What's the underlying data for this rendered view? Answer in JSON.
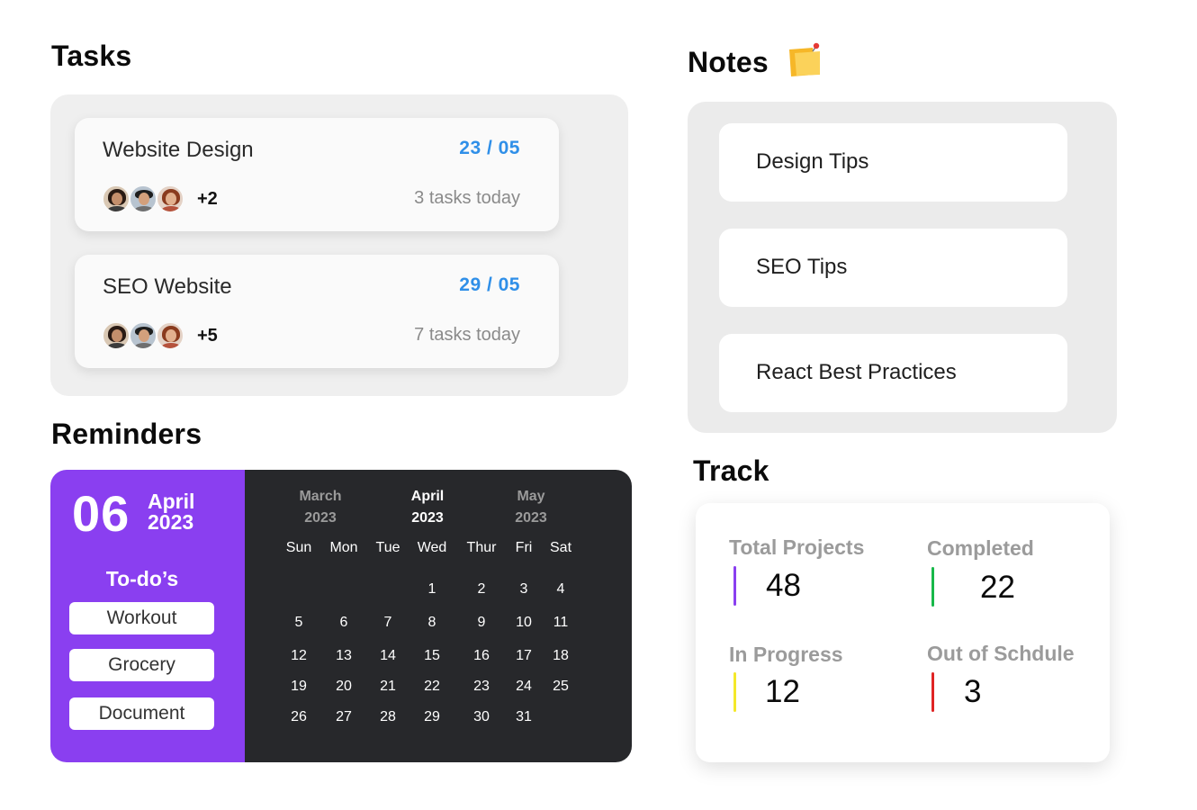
{
  "tasks": {
    "title": "Tasks",
    "items": [
      {
        "name": "Website Design",
        "date": "23 / 05",
        "extra_members": "+2",
        "count_text": "3 tasks today"
      },
      {
        "name": "SEO Website",
        "date": "29 / 05",
        "extra_members": "+5",
        "count_text": "7 tasks today"
      }
    ]
  },
  "notes": {
    "title": "Notes",
    "icon": "sticky-note-pin-icon",
    "items": [
      "Design Tips",
      "SEO Tips",
      "React Best Practices"
    ]
  },
  "reminders": {
    "title": "Reminders",
    "day": "06",
    "month": "April",
    "year": "2023",
    "todo_title": "To-do’s",
    "todos": [
      "Workout",
      "Grocery",
      "Document"
    ],
    "calendar": {
      "months": [
        {
          "name": "March",
          "year": "2023"
        },
        {
          "name": "April",
          "year": "2023"
        },
        {
          "name": "May",
          "year": "2023"
        }
      ],
      "weekdays": [
        "Sun",
        "Mon",
        "Tue",
        "Wed",
        "Thur",
        "Fri",
        "Sat"
      ],
      "weeks": [
        [
          "",
          "",
          "",
          "1",
          "2",
          "3",
          "4"
        ],
        [
          "5",
          "6",
          "7",
          "8",
          "9",
          "10",
          "11"
        ],
        [
          "12",
          "13",
          "14",
          "15",
          "16",
          "17",
          "18"
        ],
        [
          "19",
          "20",
          "21",
          "22",
          "23",
          "24",
          "25"
        ],
        [
          "26",
          "27",
          "28",
          "29",
          "30",
          "31",
          ""
        ]
      ]
    },
    "accent_color": "#8a3ff0",
    "calendar_bg": "#27282b"
  },
  "track": {
    "title": "Track",
    "metrics": [
      {
        "label": "Total Projects",
        "value": "48",
        "color": "#8a3ff0"
      },
      {
        "label": "Completed",
        "value": "22",
        "color": "#18b84a"
      },
      {
        "label": "In Progress",
        "value": "12",
        "color": "#f4e82a"
      },
      {
        "label": "Out of Schdule",
        "value": "3",
        "color": "#e02424"
      }
    ]
  }
}
